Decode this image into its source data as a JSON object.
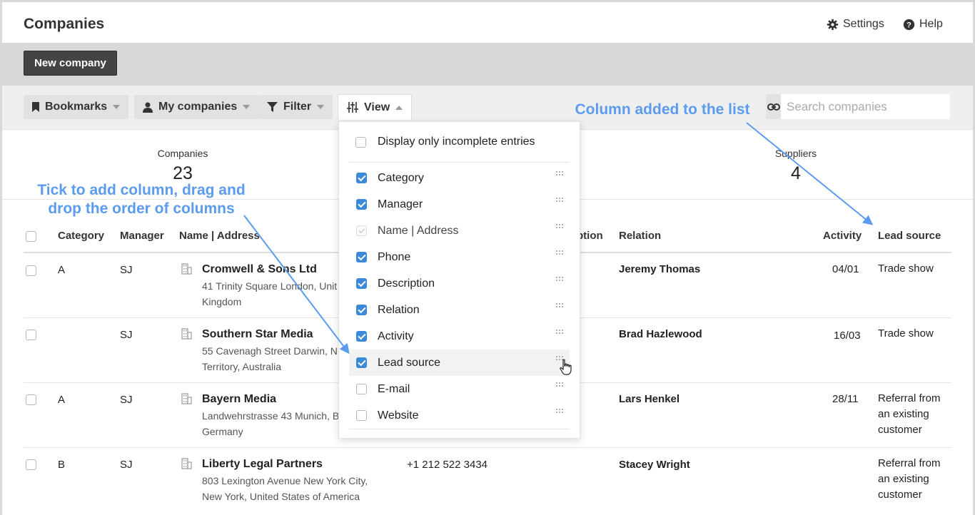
{
  "header": {
    "title": "Companies",
    "settings_label": "Settings",
    "help_label": "Help"
  },
  "actions": {
    "new_company_label": "New company"
  },
  "toolbar": {
    "bookmarks_label": "Bookmarks",
    "my_companies_label": "My companies",
    "filter_label": "Filter",
    "view_label": "View",
    "search_placeholder": "Search companies"
  },
  "stats": [
    {
      "label": "Companies",
      "value": "23"
    },
    {
      "label": "Suppliers",
      "value": "4"
    }
  ],
  "table": {
    "headers": {
      "category": "Category",
      "manager": "Manager",
      "name_address": "Name | Address",
      "description_partial": "ption",
      "relation": "Relation",
      "activity": "Activity",
      "lead_source": "Lead source"
    },
    "rows": [
      {
        "category": "A",
        "manager": "SJ",
        "name": "Cromwell & Sons Ltd",
        "address_line1": "41 Trinity Square London, Unit",
        "address_line2": "Kingdom",
        "phone": "",
        "relation": "Jeremy Thomas",
        "activity": "04/01",
        "lead_source_lines": [
          "Trade show"
        ]
      },
      {
        "category": "",
        "manager": "SJ",
        "name": "Southern Star Media",
        "address_line1": "55 Cavenagh Street Darwin, N",
        "address_line2": "Territory, Australia",
        "phone": "",
        "relation": "Brad Hazlewood",
        "activity": "16/03",
        "lead_source_lines": [
          "Trade show"
        ]
      },
      {
        "category": "A",
        "manager": "SJ",
        "name": "Bayern Media",
        "address_line1": "Landwehrstrasse 43 Munich, B",
        "address_line2": "Germany",
        "phone": "",
        "relation": "Lars Henkel",
        "activity": "28/11",
        "lead_source_lines": [
          "Referral from",
          "an existing",
          "customer"
        ]
      },
      {
        "category": "B",
        "manager": "SJ",
        "name": "Liberty Legal Partners",
        "address_line1": "803 Lexington Avenue New York City,",
        "address_line2": "New York, United States of America",
        "phone": "+1 212 522 3434",
        "relation": "Stacey Wright",
        "activity": "",
        "lead_source_lines": [
          "Referral from",
          "an existing",
          "customer"
        ]
      }
    ]
  },
  "view_menu": {
    "incomplete_label": "Display only incomplete entries",
    "columns": [
      {
        "label": "Category",
        "checked": true
      },
      {
        "label": "Manager",
        "checked": true
      },
      {
        "label": "Name | Address",
        "checked": true,
        "locked": true
      },
      {
        "label": "Phone",
        "checked": true
      },
      {
        "label": "Description",
        "checked": true
      },
      {
        "label": "Relation",
        "checked": true
      },
      {
        "label": "Activity",
        "checked": true
      },
      {
        "label": "Lead source",
        "checked": true
      },
      {
        "label": "E-mail",
        "checked": false
      },
      {
        "label": "Website",
        "checked": false
      }
    ]
  },
  "annotations": {
    "column_added": "Column added to the list",
    "tick_line1": "Tick to add column, drag and",
    "tick_line2": "drop the order of columns"
  },
  "colors": {
    "accent": "#3b8ad9",
    "annotation": "#5b9bf0",
    "dark_button": "#444444"
  }
}
